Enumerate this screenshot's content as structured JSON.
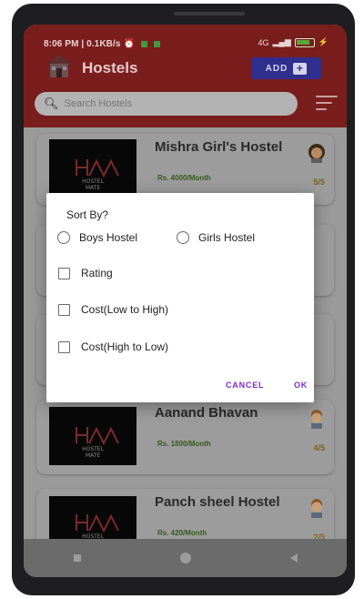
{
  "status": {
    "time_info": "8:06 PM | 0.1KB/s",
    "right_text": "4G"
  },
  "header": {
    "title": "Hostels",
    "add_label": "ADD"
  },
  "search": {
    "placeholder": "Search Hostels"
  },
  "cards": [
    {
      "name": "Mishra Girl's Hostel",
      "price": "Rs. 4000/Month",
      "rating": "5/5",
      "avatar": "girl-avatar-icon"
    },
    {
      "name": "Aanand Bhavan",
      "price": "Rs. 1800/Month",
      "rating": "4/5",
      "avatar": "boy-avatar-icon"
    },
    {
      "name": "Panch sheel Hostel",
      "price": "Rs. 420/Month",
      "rating": "2/5",
      "avatar": "boy-avatar-icon"
    }
  ],
  "logo": {
    "line1": "HOSTEL",
    "line2": "MATE"
  },
  "dialog": {
    "title": "Sort By?",
    "radio_boys": "Boys Hostel",
    "radio_girls": "Girls Hostel",
    "check_rating": "Rating",
    "check_low_high": "Cost(Low to High)",
    "check_high_low": "Cost(High to Low)",
    "cancel": "CANCEL",
    "ok": "OK"
  },
  "colors": {
    "accent": "#7b2cd6",
    "header": "#b32b2b",
    "add_button": "#3b3bd1"
  }
}
